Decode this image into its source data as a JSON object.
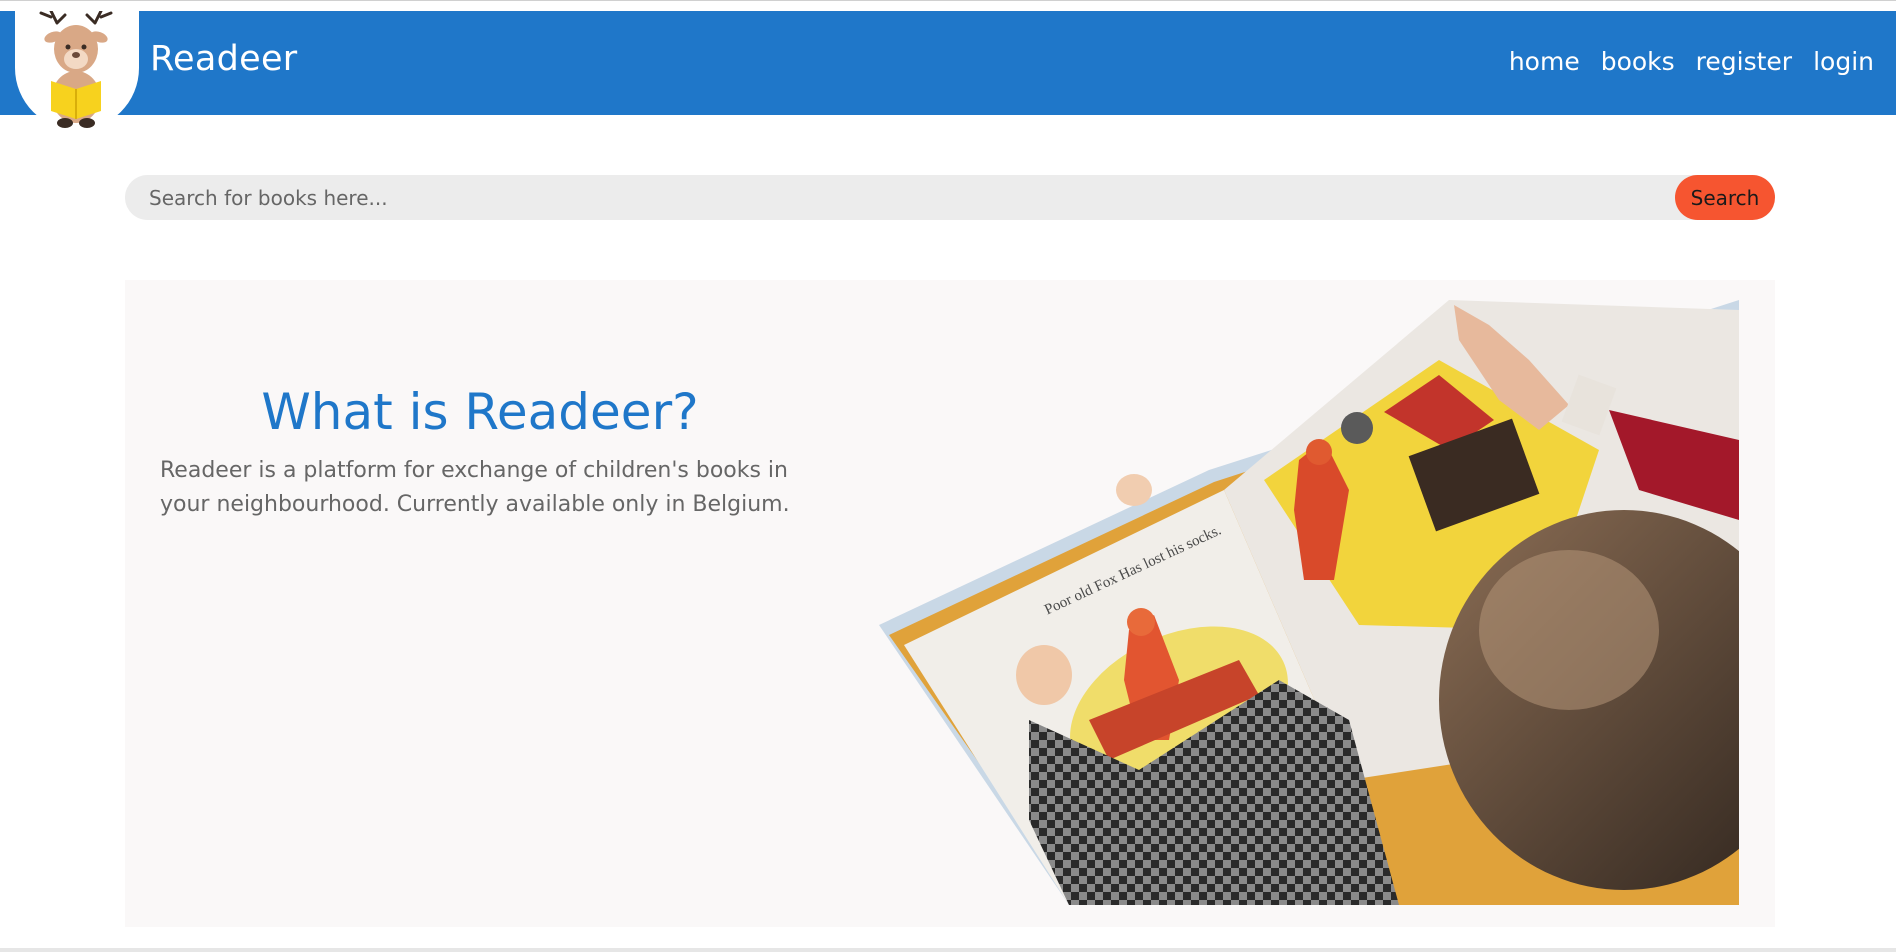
{
  "header": {
    "brand": "Readeer",
    "logo_icon": "reading-deer-icon",
    "nav": [
      {
        "label": "home"
      },
      {
        "label": "books"
      },
      {
        "label": "register"
      },
      {
        "label": "login"
      }
    ]
  },
  "search": {
    "placeholder": "Search for books here...",
    "value": "",
    "button_label": "Search"
  },
  "hero": {
    "title": "What is Readeer?",
    "description": "Readeer is a platform for exchange of children's books in your neighbourhood. Currently available only in Belgium.",
    "image_icon": "child-reading-picture-book-photo",
    "book_text": "Poor old Fox Has lost his socks."
  },
  "colors": {
    "primary": "#1f77c9",
    "accent": "#f65530",
    "hero_background": "#faf8f8"
  }
}
